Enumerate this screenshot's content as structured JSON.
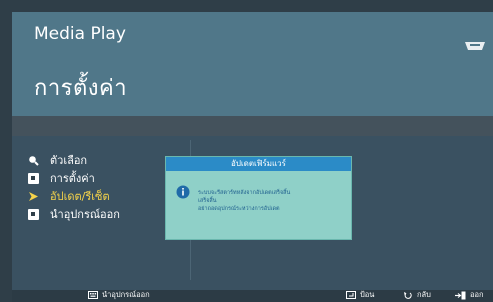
{
  "header": {
    "app_title": "Media Play",
    "page_title": "การตั้งค่า",
    "header_icon": "hdmi-connector-icon"
  },
  "menu": {
    "items": [
      {
        "label": "ตัวเลือก",
        "icon": "magnifier-icon",
        "selected": false
      },
      {
        "label": "การตั้งค่า",
        "icon": "settings-square-icon",
        "selected": false
      },
      {
        "label": "อัปเดต/รีเซ็ต",
        "icon": "arrow-right-icon",
        "selected": true
      },
      {
        "label": "นำอุปกรณ์ออก",
        "icon": "eject-square-icon",
        "selected": false
      }
    ]
  },
  "dialog": {
    "title": "อัปเดตเฟิร์มแวร์",
    "icon": "info-icon",
    "lines": [
      "ระบบจะรีสตาร์ทหลังจากอัปเดตเสร็จสิ้น",
      "เสร็จสิ้น",
      "อย่าถอดอุปกรณ์ระหว่างการอัปเดต"
    ]
  },
  "footer": {
    "remove_device": "นำอุปกรณ์ออก",
    "enter": "ป้อน",
    "back": "กลับ",
    "exit": "ออก"
  },
  "colors": {
    "background": "#2f3e48",
    "header": "#507789",
    "body": "#3a5161",
    "selected_text": "#f5d34a",
    "dialog_bg": "#8fd0c8",
    "dialog_title": "#2b8bc7"
  }
}
